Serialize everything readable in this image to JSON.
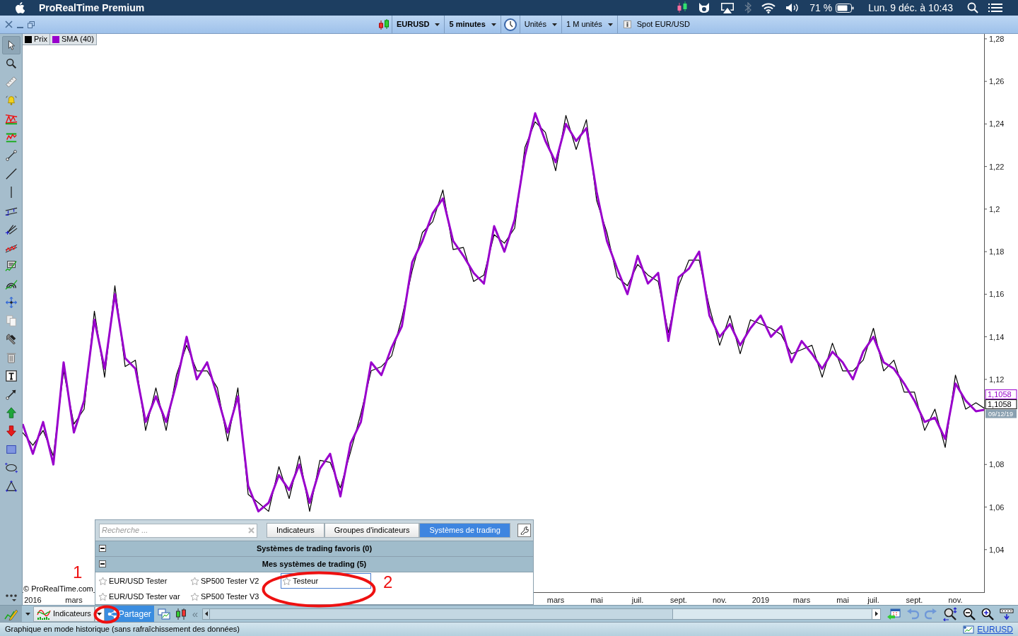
{
  "menubar": {
    "app": "ProRealTime Premium",
    "battery": "71 %",
    "clock": "Lun. 9 déc. à 10:43"
  },
  "toolbar": {
    "instrument": "EURUSD",
    "timeframe": "5 minutes",
    "units": "Unités",
    "quantity": "1 M unités",
    "description": "Spot EUR/USD"
  },
  "chart_data": {
    "type": "line",
    "legend": true,
    "ylim": [
      1.02,
      1.2823
    ],
    "categories": [
      null,
      "2016",
      null,
      null,
      null,
      "mars",
      null,
      null,
      null,
      null,
      null,
      null,
      null,
      null,
      null,
      null,
      null,
      null,
      null,
      null,
      null,
      null,
      null,
      null,
      null,
      null,
      null,
      null,
      null,
      null,
      null,
      null,
      null,
      null,
      null,
      null,
      null,
      null,
      null,
      null,
      null,
      null,
      null,
      null,
      null,
      null,
      null,
      null,
      null,
      null,
      null,
      null,
      "mars",
      null,
      null,
      null,
      "mai",
      null,
      null,
      null,
      "juil.",
      null,
      null,
      null,
      "sept.",
      null,
      null,
      null,
      "nov.",
      null,
      null,
      null,
      "2019",
      null,
      null,
      null,
      "mars",
      null,
      null,
      null,
      "mai",
      null,
      null,
      "juil.",
      null,
      null,
      null,
      "sept.",
      null,
      null,
      null,
      "nov.",
      null,
      null,
      null
    ],
    "series": [
      {
        "name": "Prix",
        "color": "#000000",
        "values": [
          1.095,
          1.089,
          1.096,
          1.084,
          1.124,
          1.099,
          1.106,
          1.152,
          1.121,
          1.164,
          1.126,
          1.129,
          1.096,
          1.116,
          1.096,
          1.122,
          1.136,
          1.124,
          1.124,
          1.116,
          1.091,
          1.116,
          1.066,
          1.062,
          1.058,
          1.079,
          1.064,
          1.084,
          1.058,
          1.082,
          1.081,
          1.069,
          1.086,
          1.104,
          1.124,
          1.126,
          1.131,
          1.149,
          1.171,
          1.189,
          1.194,
          1.209,
          1.181,
          1.182,
          1.166,
          1.169,
          1.188,
          1.184,
          1.191,
          1.229,
          1.241,
          1.236,
          1.218,
          1.244,
          1.228,
          1.242,
          1.204,
          1.189,
          1.168,
          1.164,
          1.174,
          1.169,
          1.166,
          1.142,
          1.164,
          1.176,
          1.176,
          1.154,
          1.136,
          1.15,
          1.132,
          1.148,
          1.146,
          1.144,
          1.141,
          1.132,
          1.134,
          1.136,
          1.121,
          1.137,
          1.124,
          1.124,
          1.129,
          1.144,
          1.124,
          1.129,
          1.114,
          1.114,
          1.096,
          1.106,
          1.088,
          1.122,
          1.106,
          1.109,
          1.1058
        ]
      },
      {
        "name": "SMA (40)",
        "color": "#9900cc",
        "values": [
          1.099,
          1.085,
          1.1,
          1.08,
          1.128,
          1.095,
          1.11,
          1.148,
          1.125,
          1.16,
          1.13,
          1.125,
          1.1,
          1.112,
          1.1,
          1.118,
          1.14,
          1.12,
          1.128,
          1.112,
          1.095,
          1.112,
          1.07,
          1.058,
          1.062,
          1.075,
          1.068,
          1.08,
          1.062,
          1.078,
          1.085,
          1.065,
          1.09,
          1.1,
          1.128,
          1.122,
          1.135,
          1.145,
          1.175,
          1.185,
          1.198,
          1.205,
          1.185,
          1.178,
          1.17,
          1.165,
          1.192,
          1.18,
          1.195,
          1.225,
          1.245,
          1.232,
          1.222,
          1.24,
          1.232,
          1.238,
          1.208,
          1.185,
          1.172,
          1.16,
          1.178,
          1.165,
          1.17,
          1.138,
          1.168,
          1.172,
          1.18,
          1.15,
          1.14,
          1.146,
          1.136,
          1.144,
          1.15,
          1.14,
          1.145,
          1.128,
          1.138,
          1.132,
          1.125,
          1.133,
          1.128,
          1.12,
          1.133,
          1.14,
          1.128,
          1.125,
          1.118,
          1.11,
          1.1,
          1.102,
          1.092,
          1.118,
          1.11,
          1.105,
          1.1058
        ]
      }
    ],
    "yticks": [
      {
        "value": 1.28,
        "label": "1,28"
      },
      {
        "value": 1.26,
        "label": "1,26"
      },
      {
        "value": 1.24,
        "label": "1,24"
      },
      {
        "value": 1.22,
        "label": "1,22"
      },
      {
        "value": 1.2,
        "label": "1,2"
      },
      {
        "value": 1.18,
        "label": "1,18"
      },
      {
        "value": 1.16,
        "label": "1,16"
      },
      {
        "value": 1.14,
        "label": "1,14"
      },
      {
        "value": 1.12,
        "label": "1,12"
      },
      {
        "value": 1.08,
        "label": "1,08"
      },
      {
        "value": 1.06,
        "label": "1,06"
      },
      {
        "value": 1.04,
        "label": "1,04"
      }
    ]
  },
  "price_tags": [
    {
      "text": "1,1058",
      "color": "#9900cc"
    },
    {
      "text": "1,1058",
      "color": "#000000"
    }
  ],
  "date_tag": "09/12/19",
  "copyright": "© ProRealTime.com",
  "panel": {
    "search": {
      "placeholder": "Recherche ..."
    },
    "tabs": [
      {
        "label": "Indicateurs",
        "selected": false
      },
      {
        "label": "Groupes d'indicateurs",
        "selected": false
      },
      {
        "label": "Systèmes de trading",
        "selected": true
      }
    ],
    "sections": [
      {
        "title": "Systèmes de trading favoris (0)",
        "expanded": true
      },
      {
        "title": "Mes systèmes de trading (5)",
        "expanded": true,
        "items": [
          {
            "label": "EUR/USD Tester",
            "favorite": false,
            "selected": false
          },
          {
            "label": "SP500 Tester V2",
            "favorite": false,
            "selected": false
          },
          {
            "label": "Testeur",
            "favorite": false,
            "selected": true
          },
          {
            "label": "EUR/USD Tester var",
            "favorite": false,
            "selected": false
          },
          {
            "label": "SP500 Tester V3",
            "favorite": false,
            "selected": false
          }
        ]
      }
    ]
  },
  "bottom_toolbar": {
    "indicators": "Indicateurs",
    "share": "Partager",
    "collapse": "«"
  },
  "status_bar": {
    "message": "Graphique en mode historique (sans rafraîchissement des données)",
    "instrument": "EURUSD"
  },
  "annotations": [
    {
      "label": "1"
    },
    {
      "label": "2"
    }
  ]
}
